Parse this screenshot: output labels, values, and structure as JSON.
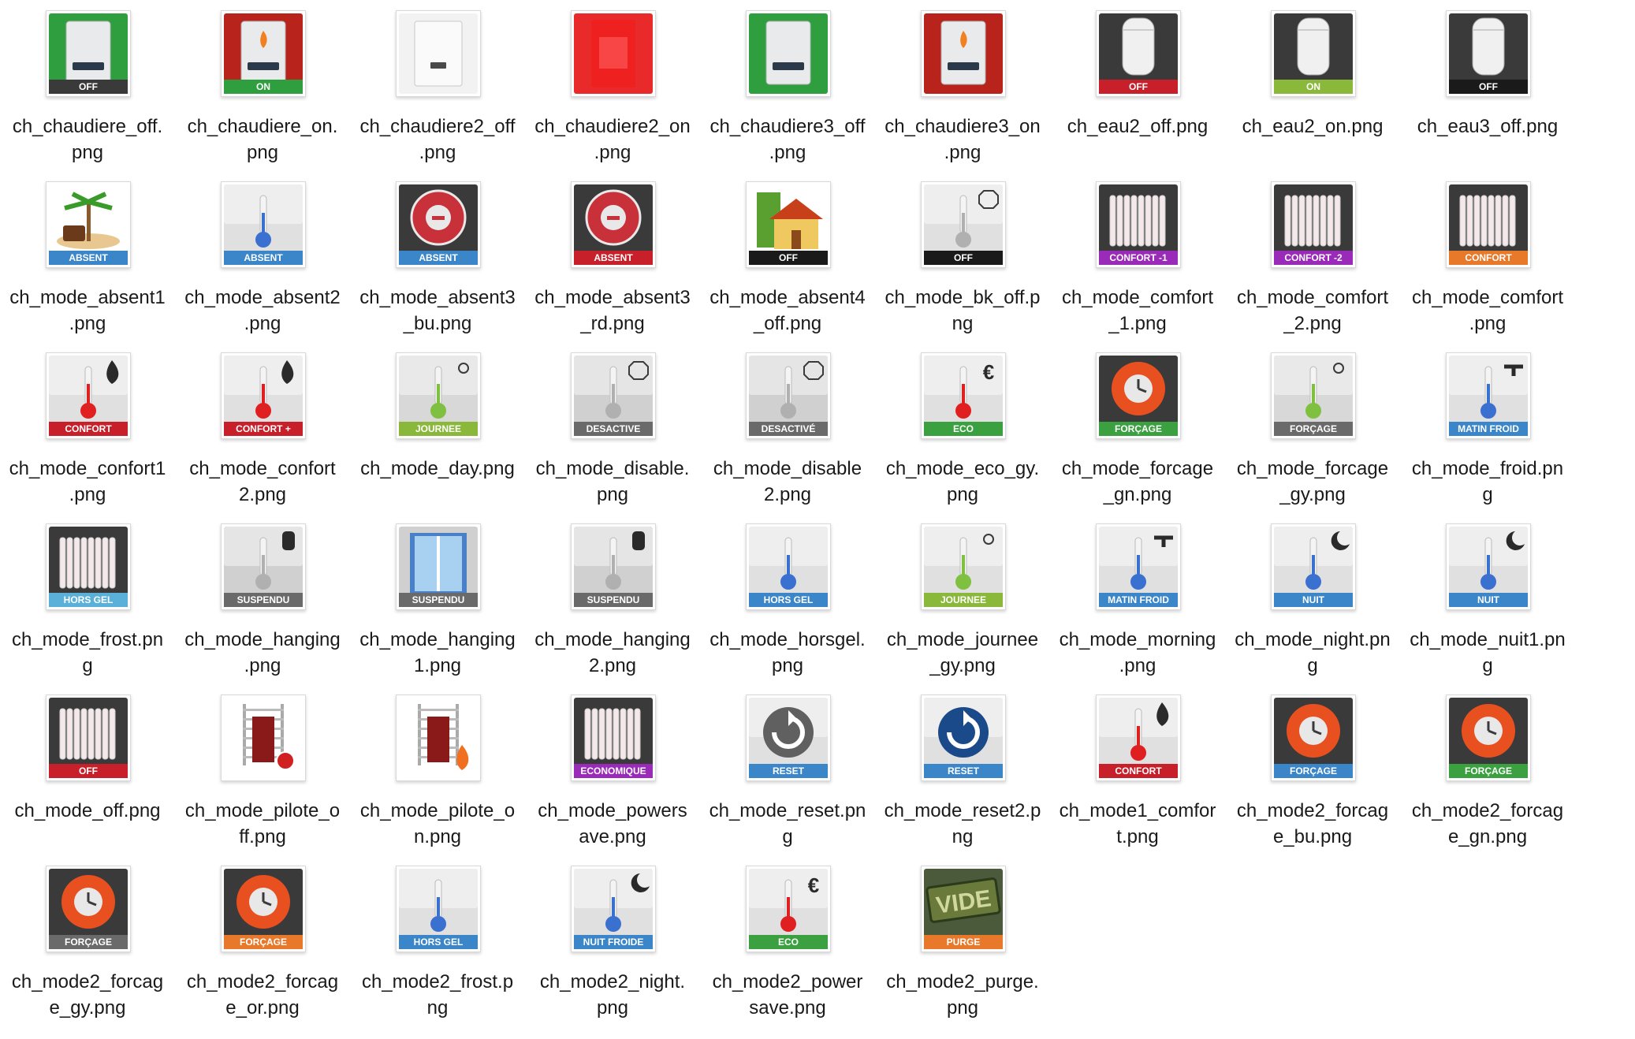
{
  "files": [
    {
      "name": "ch_chaudiere_off.png",
      "lines": [
        "ch_chaudiere_off.",
        "png"
      ],
      "icon": "boiler-icon",
      "bg": "#2e9e3e",
      "badge": "OFF",
      "badge_color": "#3a3a3a"
    },
    {
      "name": "ch_chaudiere_on.png",
      "lines": [
        "ch_chaudiere_on.",
        "png"
      ],
      "icon": "boiler-flame-icon",
      "bg": "#b8231c",
      "badge": "ON",
      "badge_color": "#2e9e3e"
    },
    {
      "name": "ch_chaudiere2_off.png",
      "lines": [
        "ch_chaudiere2_off",
        ".png"
      ],
      "icon": "boiler-white-icon",
      "bg": "#f2f2f2",
      "badge": "",
      "badge_color": ""
    },
    {
      "name": "ch_chaudiere2_on.png",
      "lines": [
        "ch_chaudiere2_on",
        ".png"
      ],
      "icon": "boiler-red-icon",
      "bg": "#e82a2a",
      "badge": "",
      "badge_color": ""
    },
    {
      "name": "ch_chaudiere3_off.png",
      "lines": [
        "ch_chaudiere3_off",
        ".png"
      ],
      "icon": "boiler-icon",
      "bg": "#2e9e3e",
      "badge": "",
      "badge_color": ""
    },
    {
      "name": "ch_chaudiere3_on.png",
      "lines": [
        "ch_chaudiere3_on",
        ".png"
      ],
      "icon": "boiler-flame-icon",
      "bg": "#b8231c",
      "badge": "",
      "badge_color": ""
    },
    {
      "name": "ch_eau2_off.png",
      "lines": [
        "ch_eau2_off.png"
      ],
      "icon": "water-heater-icon",
      "bg": "#3a3a3a",
      "badge": "OFF",
      "badge_color": "#c8202a"
    },
    {
      "name": "ch_eau2_on.png",
      "lines": [
        "ch_eau2_on.png"
      ],
      "icon": "water-heater-icon",
      "bg": "#3a3a3a",
      "badge": "ON",
      "badge_color": "#8ab83a"
    },
    {
      "name": "ch_eau3_off.png",
      "lines": [
        "ch_eau3_off.png"
      ],
      "icon": "water-heater-icon",
      "bg": "#3a3a3a",
      "badge": "OFF",
      "badge_color": "#1a1a1a"
    },
    {
      "name": "ch_mode_absent1.png",
      "lines": [
        "ch_mode_absent1",
        ".png"
      ],
      "icon": "palm-island-icon",
      "bg": "#ffffff",
      "badge": "ABSENT",
      "badge_color": "#3a86c8"
    },
    {
      "name": "ch_mode_absent2.png",
      "lines": [
        "ch_mode_absent2",
        ".png"
      ],
      "icon": "thermometer-icon",
      "bg": "#e0e0e0",
      "badge": "ABSENT",
      "badge_color": "#3a86c8"
    },
    {
      "name": "ch_mode_absent3_bu.png",
      "lines": [
        "ch_mode_absent3",
        "_bu.png"
      ],
      "icon": "weekend-seal-icon",
      "bg": "#3a3a3a",
      "badge": "ABSENT",
      "badge_color": "#3a86c8"
    },
    {
      "name": "ch_mode_absent3_rd.png",
      "lines": [
        "ch_mode_absent3",
        "_rd.png"
      ],
      "icon": "weekend-seal-icon",
      "bg": "#3a3a3a",
      "badge": "ABSENT",
      "badge_color": "#c8202a"
    },
    {
      "name": "ch_mode_absent4_off.png",
      "lines": [
        "ch_mode_absent4",
        "_off.png"
      ],
      "icon": "house-icon",
      "bg": "#ffffff",
      "badge": "OFF",
      "badge_color": "#1a1a1a"
    },
    {
      "name": "ch_mode_bk_off.png",
      "lines": [
        "ch_mode_bk_off.p",
        "ng"
      ],
      "icon": "thermometer-stop-icon",
      "bg": "#e0e0e0",
      "badge": "OFF",
      "badge_color": "#1a1a1a"
    },
    {
      "name": "ch_mode_comfort_1.png",
      "lines": [
        "ch_mode_comfort",
        "_1.png"
      ],
      "icon": "radiator-icon",
      "bg": "#3a3a3a",
      "badge": "CONFORT -1",
      "badge_color": "#9a2ab8"
    },
    {
      "name": "ch_mode_comfort_2.png",
      "lines": [
        "ch_mode_comfort",
        "_2.png"
      ],
      "icon": "radiator-icon",
      "bg": "#3a3a3a",
      "badge": "CONFORT -2",
      "badge_color": "#9a2ab8"
    },
    {
      "name": "ch_mode_comfort.png",
      "lines": [
        "ch_mode_comfort",
        ".png"
      ],
      "icon": "radiator-icon",
      "bg": "#3a3a3a",
      "badge": "CONFORT",
      "badge_color": "#e8782a"
    },
    {
      "name": "ch_mode_confort1.png",
      "lines": [
        "ch_mode_confort1",
        ".png"
      ],
      "icon": "thermometer-flame-icon",
      "bg": "#e0e0e0",
      "badge": "CONFORT",
      "badge_color": "#c8202a"
    },
    {
      "name": "ch_mode_confort2.png",
      "lines": [
        "ch_mode_confort",
        "2.png"
      ],
      "icon": "thermometer-flame-icon",
      "bg": "#e0e0e0",
      "badge": "CONFORT +",
      "badge_color": "#c8202a"
    },
    {
      "name": "ch_mode_day.png",
      "lines": [
        "ch_mode_day.png"
      ],
      "icon": "thermometer-sun-icon",
      "bg": "#d8d8d8",
      "badge": "JOURNEE",
      "badge_color": "#8ab83a"
    },
    {
      "name": "ch_mode_disable.png",
      "lines": [
        "ch_mode_disable.",
        "png"
      ],
      "icon": "thermometer-stop-icon",
      "bg": "#d0d0d0",
      "badge": "DESACTIVE",
      "badge_color": "#6a6a6a"
    },
    {
      "name": "ch_mode_disable2.png",
      "lines": [
        "ch_mode_disable",
        "2.png"
      ],
      "icon": "thermometer-stop-icon",
      "bg": "#d0d0d0",
      "badge": "DESACTIVÉ",
      "badge_color": "#6a6a6a"
    },
    {
      "name": "ch_mode_eco_gy.png",
      "lines": [
        "ch_mode_eco_gy.",
        "png"
      ],
      "icon": "thermometer-euro-icon",
      "bg": "#e0e0e0",
      "badge": "ECO",
      "badge_color": "#3aa040"
    },
    {
      "name": "ch_mode_forcage_gn.png",
      "lines": [
        "ch_mode_forcage",
        "_gn.png"
      ],
      "icon": "forcage-clock-icon",
      "bg": "#3a3a3a",
      "badge": "FORÇAGE",
      "badge_color": "#3aa040"
    },
    {
      "name": "ch_mode_forcage_gy.png",
      "lines": [
        "ch_mode_forcage",
        "_gy.png"
      ],
      "icon": "thermometer-sun-icon",
      "bg": "#d8d8d8",
      "badge": "FORÇAGE",
      "badge_color": "#6a6a6a"
    },
    {
      "name": "ch_mode_froid.png",
      "lines": [
        "ch_mode_froid.pn",
        "g"
      ],
      "icon": "thermometer-tap-icon",
      "bg": "#e0e0e0",
      "badge": "MATIN FROID",
      "badge_color": "#3a86c8"
    },
    {
      "name": "ch_mode_frost.png",
      "lines": [
        "ch_mode_frost.pn",
        "g"
      ],
      "icon": "radiator-icon",
      "bg": "#3a3a3a",
      "badge": "HORS GEL",
      "badge_color": "#5ab0d8"
    },
    {
      "name": "ch_mode_hanging.png",
      "lines": [
        "ch_mode_hanging",
        ".png"
      ],
      "icon": "thermometer-hand-icon",
      "bg": "#d0d0d0",
      "badge": "SUSPENDU",
      "badge_color": "#6a6a6a"
    },
    {
      "name": "ch_mode_hanging1.png",
      "lines": [
        "ch_mode_hanging",
        "1.png"
      ],
      "icon": "shower-icon",
      "bg": "#d0d0d0",
      "badge": "SUSPENDU",
      "badge_color": "#6a6a6a"
    },
    {
      "name": "ch_mode_hanging2.png",
      "lines": [
        "ch_mode_hanging",
        "2.png"
      ],
      "icon": "thermometer-hand-icon",
      "bg": "#d0d0d0",
      "badge": "SUSPENDU",
      "badge_color": "#6a6a6a"
    },
    {
      "name": "ch_mode_horsgel.png",
      "lines": [
        "ch_mode_horsgel.",
        "png"
      ],
      "icon": "thermometer-icon",
      "bg": "#e0e0e0",
      "badge": "HORS GEL",
      "badge_color": "#3a86c8"
    },
    {
      "name": "ch_mode_journee_gy.png",
      "lines": [
        "ch_mode_journee",
        "_gy.png"
      ],
      "icon": "thermometer-sun-icon",
      "bg": "#e0e0e0",
      "badge": "JOURNEE",
      "badge_color": "#8ab83a"
    },
    {
      "name": "ch_mode_morning.png",
      "lines": [
        "ch_mode_morning",
        ".png"
      ],
      "icon": "thermometer-tap-icon",
      "bg": "#e0e0e0",
      "badge": "MATIN FROID",
      "badge_color": "#3a86c8"
    },
    {
      "name": "ch_mode_night.png",
      "lines": [
        "ch_mode_night.pn",
        "g"
      ],
      "icon": "thermometer-moon-icon",
      "bg": "#e0e0e0",
      "badge": "NUIT",
      "badge_color": "#3a86c8"
    },
    {
      "name": "ch_mode_nuit1.png",
      "lines": [
        "ch_mode_nuit1.pn",
        "g"
      ],
      "icon": "thermometer-moon-icon",
      "bg": "#e0e0e0",
      "badge": "NUIT",
      "badge_color": "#3a86c8"
    },
    {
      "name": "ch_mode_off.png",
      "lines": [
        "ch_mode_off.png"
      ],
      "icon": "radiator-icon",
      "bg": "#3a3a3a",
      "badge": "OFF",
      "badge_color": "#c8202a"
    },
    {
      "name": "ch_mode_pilote_off.png",
      "lines": [
        "ch_mode_pilote_o",
        "ff.png"
      ],
      "icon": "towel-rail-off-icon",
      "bg": "#ffffff",
      "badge": "",
      "badge_color": ""
    },
    {
      "name": "ch_mode_pilote_on.png",
      "lines": [
        "ch_mode_pilote_o",
        "n.png"
      ],
      "icon": "towel-rail-flame-icon",
      "bg": "#ffffff",
      "badge": "",
      "badge_color": ""
    },
    {
      "name": "ch_mode_powersave.png",
      "lines": [
        "ch_mode_powers",
        "ave.png"
      ],
      "icon": "radiator-icon",
      "bg": "#3a3a3a",
      "badge": "ECONOMIQUE",
      "badge_color": "#9a2ab8"
    },
    {
      "name": "ch_mode_reset.png",
      "lines": [
        "ch_mode_reset.pn",
        "g"
      ],
      "icon": "reset-arrow-icon",
      "bg": "#e0e0e0",
      "badge": "RESET",
      "badge_color": "#3a86c8"
    },
    {
      "name": "ch_mode_reset2.png",
      "lines": [
        "ch_mode_reset2.p",
        "ng"
      ],
      "icon": "reset-arrow-blue-icon",
      "bg": "#e0e0e0",
      "badge": "RESET",
      "badge_color": "#3a86c8"
    },
    {
      "name": "ch_mode1_comfort.png",
      "lines": [
        "ch_mode1_comfor",
        "t.png"
      ],
      "icon": "thermometer-flame-icon",
      "bg": "#e0e0e0",
      "badge": "CONFORT",
      "badge_color": "#c8202a"
    },
    {
      "name": "ch_mode2_forcage_bu.png",
      "lines": [
        "ch_mode2_forcag",
        "e_bu.png"
      ],
      "icon": "forcage-clock-icon",
      "bg": "#3a3a3a",
      "badge": "FORÇAGE",
      "badge_color": "#3a86c8"
    },
    {
      "name": "ch_mode2_forcage_gn.png",
      "lines": [
        "ch_mode2_forcag",
        "e_gn.png"
      ],
      "icon": "forcage-clock-icon",
      "bg": "#3a3a3a",
      "badge": "FORÇAGE",
      "badge_color": "#3aa040"
    },
    {
      "name": "ch_mode2_forcage_gy.png",
      "lines": [
        "ch_mode2_forcag",
        "e_gy.png"
      ],
      "icon": "forcage-clock-icon",
      "bg": "#3a3a3a",
      "badge": "FORÇAGE",
      "badge_color": "#6a6a6a"
    },
    {
      "name": "ch_mode2_forcage_or.png",
      "lines": [
        "ch_mode2_forcag",
        "e_or.png"
      ],
      "icon": "forcage-clock-icon",
      "bg": "#3a3a3a",
      "badge": "FORÇAGE",
      "badge_color": "#e8782a"
    },
    {
      "name": "ch_mode2_frost.png",
      "lines": [
        "ch_mode2_frost.p",
        "ng"
      ],
      "icon": "thermometer-icon",
      "bg": "#e0e0e0",
      "badge": "HORS GEL",
      "badge_color": "#3a86c8"
    },
    {
      "name": "ch_mode2_night.png",
      "lines": [
        "ch_mode2_night.",
        "png"
      ],
      "icon": "thermometer-moon-icon",
      "bg": "#e0e0e0",
      "badge": "NUIT FROIDE",
      "badge_color": "#3a86c8"
    },
    {
      "name": "ch_mode2_powersave.png",
      "lines": [
        "ch_mode2_power",
        "save.png"
      ],
      "icon": "thermometer-euro-icon",
      "bg": "#e0e0e0",
      "badge": "ECO",
      "badge_color": "#3aa040"
    },
    {
      "name": "ch_mode2_purge.png",
      "lines": [
        "ch_mode2_purge.",
        "png"
      ],
      "icon": "vide-stamp-icon",
      "bg": "#4a5a3a",
      "badge": "PURGE",
      "badge_color": "#e8782a"
    }
  ]
}
